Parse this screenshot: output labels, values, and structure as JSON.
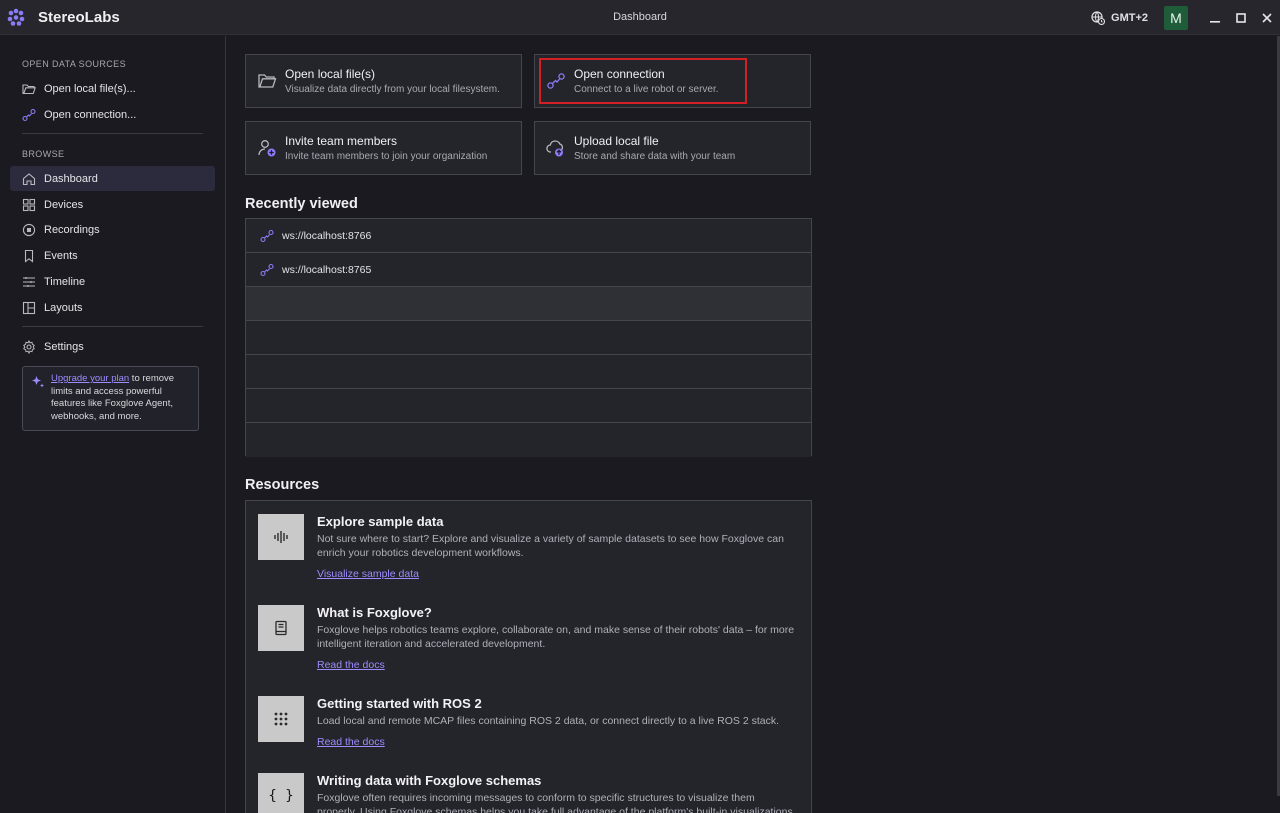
{
  "titlebar": {
    "brand": "StereoLabs",
    "title": "Dashboard",
    "timezone": "GMT+2",
    "avatar_initial": "M",
    "controls": [
      "minimize",
      "maximize",
      "close"
    ]
  },
  "sidebar": {
    "open_section": "OPEN DATA SOURCES",
    "open_items": [
      {
        "label": "Open local file(s)...",
        "icon": "folder-icon"
      },
      {
        "label": "Open connection...",
        "icon": "connection-icon"
      }
    ],
    "browse_section": "BROWSE",
    "browse_items": [
      {
        "label": "Dashboard",
        "icon": "home-icon",
        "active": true
      },
      {
        "label": "Devices",
        "icon": "grid-icon"
      },
      {
        "label": "Recordings",
        "icon": "record-icon"
      },
      {
        "label": "Events",
        "icon": "bookmark-icon"
      },
      {
        "label": "Timeline",
        "icon": "timeline-icon"
      },
      {
        "label": "Layouts",
        "icon": "layouts-icon"
      }
    ],
    "settings_label": "Settings",
    "upgrade": {
      "link": "Upgrade your plan",
      "text": " to remove limits and access powerful features like Foxglove Agent, webhooks, and more."
    }
  },
  "actions": [
    {
      "title": "Open local file(s)",
      "subtitle": "Visualize data directly from your local filesystem.",
      "icon": "folder-icon"
    },
    {
      "title": "Open connection",
      "subtitle": "Connect to a live robot or server.",
      "icon": "connection-icon"
    },
    {
      "title": "Invite team members",
      "subtitle": "Invite team members to join your organization",
      "icon": "user-add-icon"
    },
    {
      "title": "Upload local file",
      "subtitle": "Store and share data with your team",
      "icon": "cloud-upload-icon"
    }
  ],
  "recent": {
    "heading": "Recently viewed",
    "items": [
      "ws://localhost:8766",
      "ws://localhost:8765"
    ]
  },
  "resources": {
    "heading": "Resources",
    "items": [
      {
        "title": "Explore sample data",
        "description": "Not sure where to start? Explore and visualize a variety of sample datasets to see how Foxglove can enrich your robotics development workflows.",
        "link": "Visualize sample data",
        "icon": "waveform-icon"
      },
      {
        "title": "What is Foxglove?",
        "description": "Foxglove helps robotics teams explore, collaborate on, and make sense of their robots' data – for more intelligent iteration and accelerated development.",
        "link": "Read the docs",
        "icon": "book-icon"
      },
      {
        "title": "Getting started with ROS 2",
        "description": "Load local and remote MCAP files containing ROS 2 data, or connect directly to a live ROS 2 stack.",
        "link": "Read the docs",
        "icon": "dots-grid-icon"
      },
      {
        "title": "Writing data with Foxglove schemas",
        "description": "Foxglove often requires incoming messages to conform to specific structures to visualize them properly. Using Foxglove schemas helps you take full advantage of the platform's built-in visualizations.",
        "link": "",
        "icon": "braces-icon"
      }
    ]
  },
  "colors": {
    "accent": "#9d8cff",
    "highlight": "#d11f24",
    "background": "#1a1a20"
  }
}
